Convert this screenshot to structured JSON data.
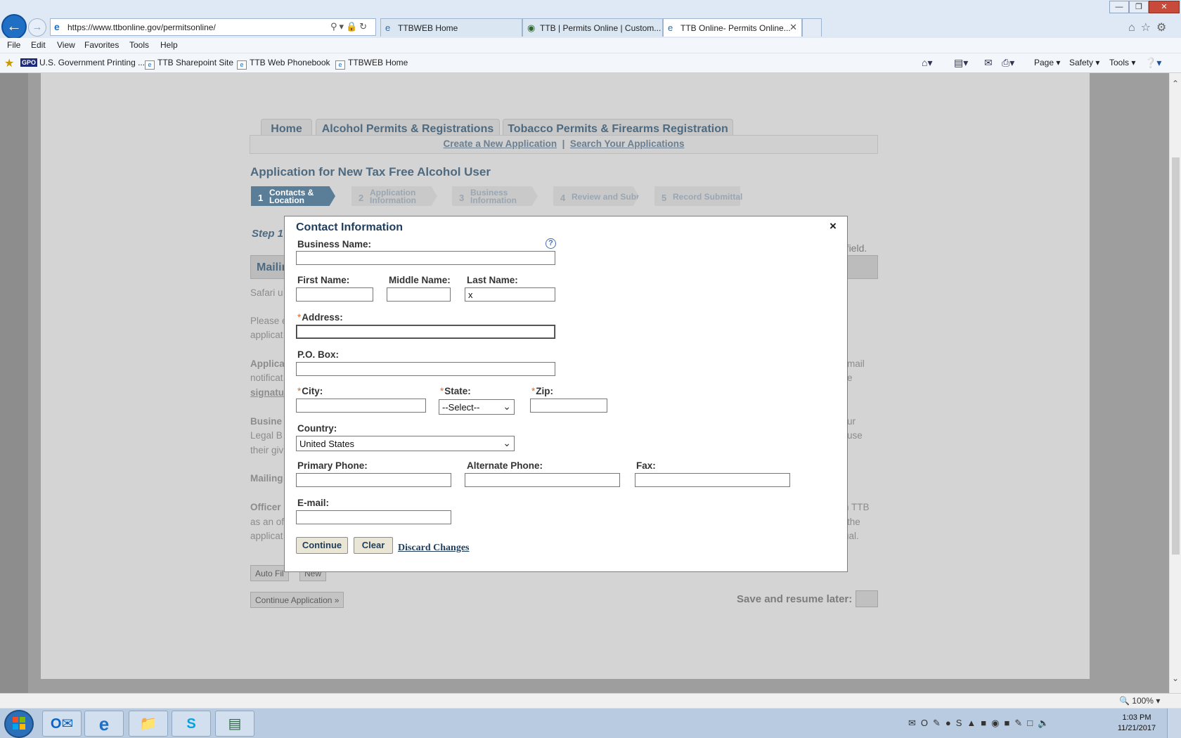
{
  "browser": {
    "url": "https://www.ttbonline.gov/permitsonline/",
    "tabs": [
      {
        "title": "TTBWEB Home",
        "active": false
      },
      {
        "title": "TTB | Permits Online | Custom...",
        "active": false
      },
      {
        "title": "TTB Online- Permits Online...",
        "active": true
      }
    ],
    "menu": [
      "File",
      "Edit",
      "View",
      "Favorites",
      "Tools",
      "Help"
    ],
    "favorites": [
      "U.S. Government Printing ...",
      "TTB Sharepoint Site",
      "TTB Web Phonebook",
      "TTBWEB Home"
    ],
    "gpo_badge": "GPO",
    "commands": [
      "Page",
      "Safety",
      "Tools"
    ],
    "zoom": "100%",
    "icons": [
      "back-icon",
      "forward-icon",
      "search-icon",
      "lock-icon",
      "refresh-icon",
      "home-icon",
      "star-icon",
      "gear-icon"
    ]
  },
  "page": {
    "site_tabs": [
      "Home",
      "Alcohol Permits & Registrations",
      "Tobacco Permits & Firearms Registration"
    ],
    "subnav": [
      "Create a New Application",
      "Search Your Applications"
    ],
    "subnav_sep": "|",
    "app_title": "Application for New Tax Free Alcohol User",
    "steps": [
      {
        "num": "1",
        "label_line1": "Contacts &",
        "label_line2": "Location",
        "current": true
      },
      {
        "num": "2",
        "label_line1": "Application",
        "label_line2": "Information",
        "current": false
      },
      {
        "num": "3",
        "label_line1": "Business",
        "label_line2": "Information",
        "current": false
      },
      {
        "num": "4",
        "label_line1": "Review and Submit",
        "label_line2": "",
        "current": false
      },
      {
        "num": "5",
        "label_line1": "Record Submittal",
        "label_line2": "",
        "current": false
      }
    ],
    "step_heading": "Step 1",
    "required_note": "d field.",
    "mailing_header": "Mailin",
    "background_text": {
      "safari": "Safari u",
      "please_1": "Please e",
      "please_2": "applicat",
      "applica_1": "Applica",
      "applica_2": "notificat",
      "applica_3": "signatu",
      "applica_r1": "mail",
      "applica_r2": "e",
      "busine_1": "Busine",
      "busine_2": "Legal B",
      "busine_3": "their giv",
      "busine_r1": "ur",
      "busine_r2": "use",
      "mailing": "Mailing",
      "officer_1": "Officer",
      "officer_2": "as an of",
      "officer_3": "applicat",
      "officer_r1": "h TTB",
      "officer_r2": "the",
      "officer_r3": "ual."
    },
    "auto_fill_btn": "Auto Fil",
    "new_btn": "New",
    "continue_app_btn": "Continue Application »",
    "save_later": "Save and resume later:"
  },
  "modal": {
    "title": "Contact Information",
    "close": "×",
    "help": "?",
    "required_mark": "*",
    "labels": {
      "business_name": "Business Name:",
      "first_name": "First Name:",
      "middle_name": "Middle Name:",
      "last_name": "Last Name:",
      "address": "Address:",
      "po_box": "P.O. Box:",
      "city": "City:",
      "state": "State:",
      "zip": "Zip:",
      "country": "Country:",
      "primary_phone": "Primary Phone:",
      "alternate_phone": "Alternate Phone:",
      "fax": "Fax:",
      "email": "E-mail:"
    },
    "values": {
      "business_name": "",
      "first_name": "",
      "middle_name": "",
      "last_name": "x",
      "address": "",
      "po_box": "",
      "city": "",
      "state": "--Select--",
      "zip": "",
      "country": "United States",
      "primary_phone": "",
      "alternate_phone": "",
      "fax": "",
      "email": ""
    },
    "buttons": {
      "continue": "Continue",
      "clear": "Clear",
      "discard": "Discard Changes"
    }
  },
  "taskbar": {
    "apps": [
      "outlook-icon",
      "internet-explorer-icon",
      "file-explorer-icon",
      "skype-icon",
      "app-window-icon"
    ],
    "time": "1:03 PM",
    "date": "11/21/2017"
  }
}
